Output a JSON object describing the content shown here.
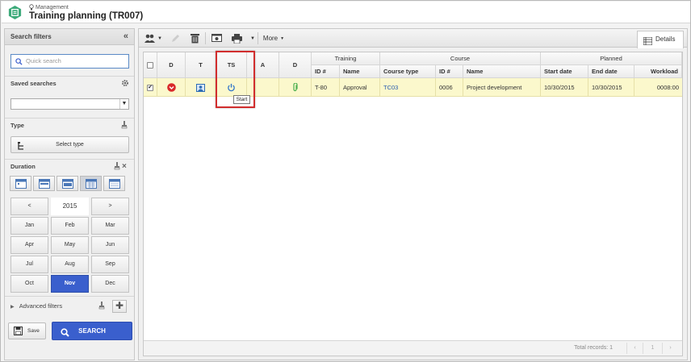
{
  "header": {
    "breadcrumb": "Management",
    "title": "Training planning (TR007)"
  },
  "filters": {
    "panel_title": "Search filters",
    "quick_search_placeholder": "Quick search",
    "saved_searches_label": "Saved searches",
    "saved_searches_value": "",
    "type_label": "Type",
    "select_type_label": "Select type",
    "duration_label": "Duration",
    "calendar": {
      "prev": "<",
      "year": "2015",
      "next": ">",
      "months": [
        "Jan",
        "Feb",
        "Mar",
        "Apr",
        "May",
        "Jun",
        "Jul",
        "Aug",
        "Sep",
        "Oct",
        "Nov",
        "Dec"
      ],
      "selected_month": "Nov"
    },
    "advanced_filters_label": "Advanced filters",
    "save_label": "Save",
    "search_label": "SEARCH"
  },
  "toolbar": {
    "more_label": "More",
    "details_label": "Details"
  },
  "grid": {
    "group_headers": {
      "training": "Training",
      "course": "Course",
      "planned": "Planned"
    },
    "columns": {
      "d": "D",
      "t": "T",
      "ts": "TS",
      "a": "A",
      "d2": "D",
      "training_id": "ID #",
      "training_name": "Name",
      "course_type": "Course type",
      "course_id": "ID #",
      "course_name": "Name",
      "start_date": "Start date",
      "end_date": "End date",
      "workload": "Workload"
    },
    "rows": [
      {
        "training_id": "T-80",
        "training_name": "Approval",
        "course_type": "TC03",
        "course_id": "0006",
        "course_name": "Project development",
        "start_date": "10/30/2015",
        "end_date": "10/30/2015",
        "workload": "0008:00"
      }
    ],
    "tooltip": "Start",
    "total_records": "Total records: 1",
    "page": "1"
  },
  "colors": {
    "accent": "#3a5fcd",
    "row_highlight": "#fbf8cc",
    "callout": "#d12d2d"
  }
}
